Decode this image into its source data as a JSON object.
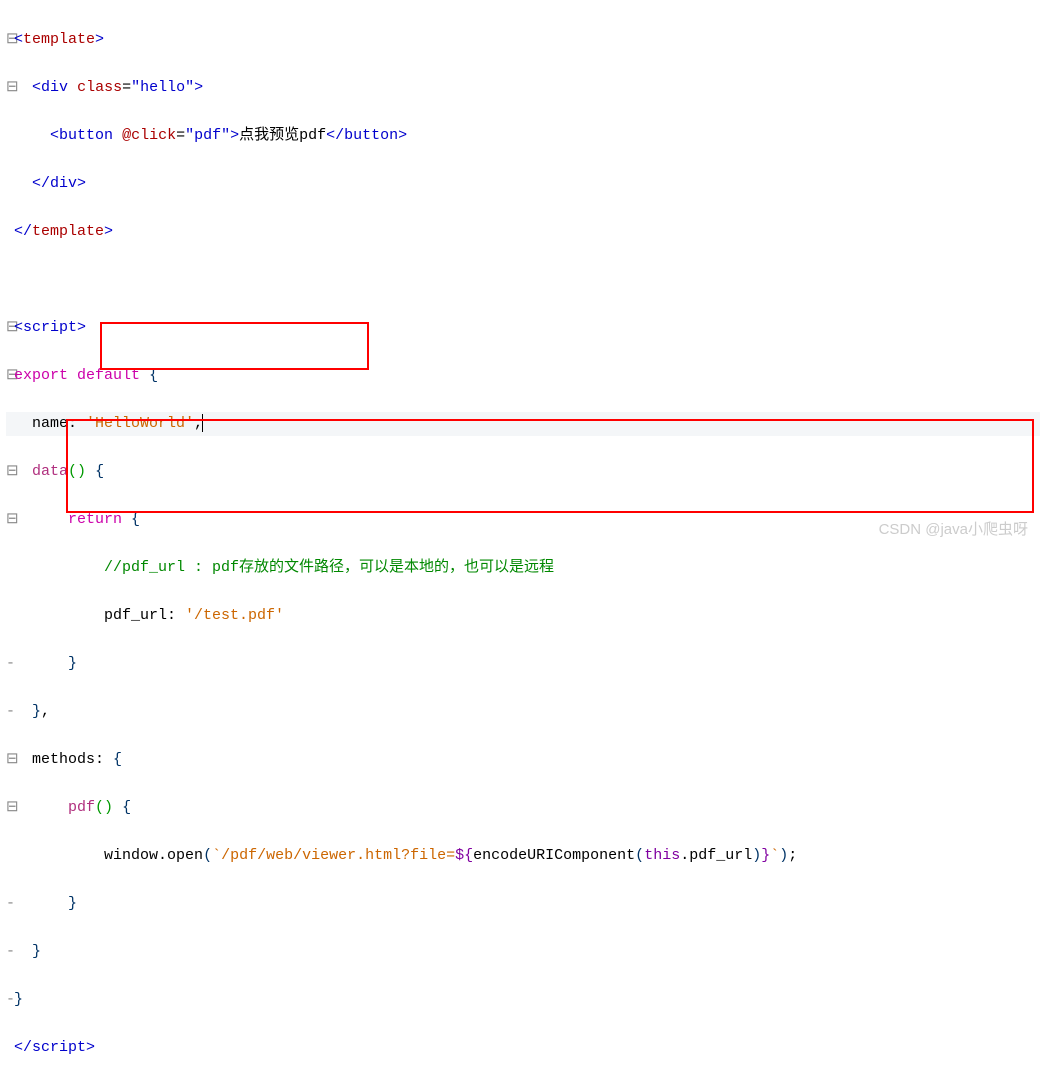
{
  "code": {
    "l1": {
      "open": "<",
      "tag": "template",
      "close": ">"
    },
    "l2": {
      "indent": "  ",
      "open": "<",
      "tag": "div",
      "attr": "class",
      "eq": "=",
      "val": "\"hello\"",
      "close": ">"
    },
    "l3": {
      "indent": "    ",
      "open": "<",
      "tag": "button",
      "attr": "@click",
      "eq": "=",
      "val": "\"pdf\"",
      "close": ">",
      "text": "点我预览pdf",
      "endopen": "</",
      "endtag": "button",
      "endclose": ">"
    },
    "l4": {
      "indent": "  ",
      "open": "</",
      "tag": "div",
      "close": ">"
    },
    "l5": {
      "open": "</",
      "tag": "template",
      "close": ">"
    },
    "l6": "",
    "l7": {
      "open": "<",
      "tag": "script",
      "close": ">"
    },
    "l8": {
      "export": "export",
      "sp": " ",
      "default": "default",
      "sp2": " ",
      "brace": "{"
    },
    "l9": {
      "indent": "  ",
      "key": "name",
      "colon": ": ",
      "val": "'HelloWorld'",
      "comma": ","
    },
    "l10": {
      "indent": "  ",
      "key": "data",
      "paren": "()",
      "sp": " ",
      "brace": "{"
    },
    "l11": {
      "indent": "      ",
      "kw": "return",
      "sp": " ",
      "brace": "{"
    },
    "l12": {
      "indent": "          ",
      "comment": "//pdf_url : pdf存放的文件路径，可以是本地的，也可以是远程"
    },
    "l13": {
      "indent": "          ",
      "key": "pdf_url",
      "colon": ": ",
      "val": "'/test.pdf'"
    },
    "l14": {
      "indent": "      ",
      "brace": "}"
    },
    "l15": {
      "indent": "  ",
      "brace": "}",
      "comma": ","
    },
    "l16": {
      "indent": "  ",
      "key": "methods",
      "colon": ": ",
      "brace": "{"
    },
    "l17": {
      "indent": "      ",
      "key": "pdf",
      "paren": "()",
      "sp": " ",
      "brace": "{"
    },
    "l18": {
      "indent": "          ",
      "obj": "window",
      "dot": ".",
      "fn": "open",
      "po": "(",
      "s1": "`/pdf/web/viewer.html?file=",
      "exo": "${",
      "enc": "encodeURIComponent",
      "po2": "(",
      "this": "this",
      "dot2": ".",
      "prop": "pdf_url",
      "pc2": ")",
      "exc": "}",
      "s2": "`",
      "pc": ")",
      "semi": ";"
    },
    "l19": {
      "indent": "      ",
      "brace": "}"
    },
    "l20": {
      "indent": "  ",
      "brace": "}"
    },
    "l21": {
      "brace": "}"
    },
    "l22": {
      "open": "</",
      "tag": "script",
      "close": ">"
    }
  },
  "watermark": "CSDN @java小爬虫呀"
}
